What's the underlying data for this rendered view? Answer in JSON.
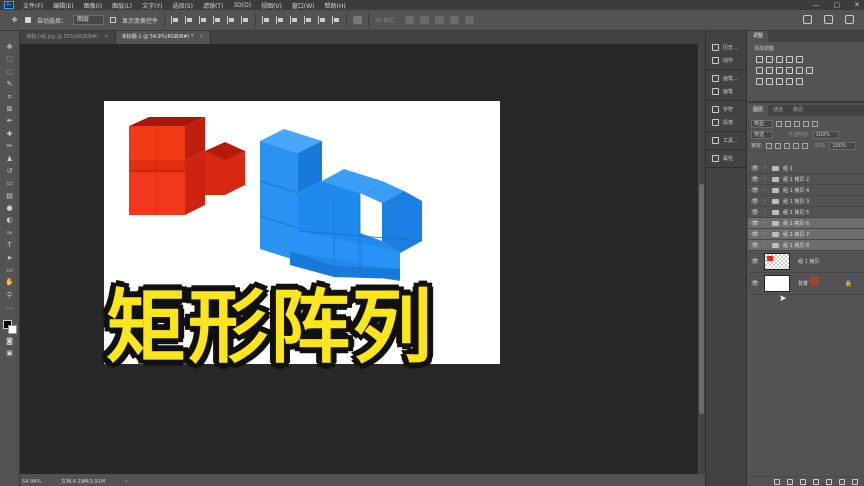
{
  "app": {
    "logo_text": "Ps",
    "menus": [
      "文件(F)",
      "编辑(E)",
      "图像(I)",
      "图层(L)",
      "文字(Y)",
      "选择(S)",
      "滤镜(T)",
      "3D(D)",
      "视图(V)",
      "窗口(W)",
      "帮助(H)"
    ],
    "window_controls": [
      "—",
      "▢",
      "✕"
    ]
  },
  "options": {
    "auto_select_label": "自动选择：",
    "auto_select_value": "图层",
    "show_transform_label": "显示变换控件",
    "mode3d_label": "3D 模式："
  },
  "tabs": [
    {
      "label": "课程小组.jpg @ 50%(RGB/8#)",
      "close": "×"
    },
    {
      "label": "未标题-1 @ 54.9%(RGB/8#) *",
      "close": "×"
    }
  ],
  "canvas": {
    "overlay_title": "矩形阵列"
  },
  "status": {
    "zoom": "54.94%",
    "doc_info": "文档:4.29M/3.91M",
    "arrow": "›"
  },
  "panel_strip": [
    {
      "items": [
        "历史...",
        "动作"
      ]
    },
    {
      "items": [
        "画笔...",
        "画笔"
      ]
    },
    {
      "items": [
        "字符",
        "段落"
      ]
    },
    {
      "items": [
        "工具..."
      ]
    },
    {
      "items": [
        "属性"
      ]
    }
  ],
  "adjustments": {
    "tabs": [
      "调整"
    ],
    "title": "添加调整"
  },
  "layers": {
    "tabs": [
      "图层",
      "通道",
      "路径"
    ],
    "filter_label": "类型",
    "blend_mode": "穿透",
    "opacity_label": "不透明度:",
    "opacity_value": "100%",
    "lock_label": "锁定:",
    "fill_label": "填充:",
    "fill_value": "100%",
    "groups": [
      {
        "name": "组 1",
        "selected": false
      },
      {
        "name": "组 1 拷贝 2",
        "selected": false
      },
      {
        "name": "组 1 拷贝 4",
        "selected": false
      },
      {
        "name": "组 1 拷贝 3",
        "selected": false
      },
      {
        "name": "组 1 拷贝 5",
        "selected": false
      },
      {
        "name": "组 1 拷贝 6",
        "selected": true
      },
      {
        "name": "组 1 拷贝 7",
        "selected": true
      },
      {
        "name": "组 1 拷贝 8",
        "selected": true
      }
    ],
    "pixel_layer": "组 1 拷贝",
    "background_layer": "背景",
    "eye": "👁",
    "chevron": "›",
    "lock_glyph": "🔒"
  },
  "colors": {
    "cube_red": "#e02a10",
    "cube_blue": "#1e8ef0",
    "title_yellow": "#fbe61e"
  }
}
